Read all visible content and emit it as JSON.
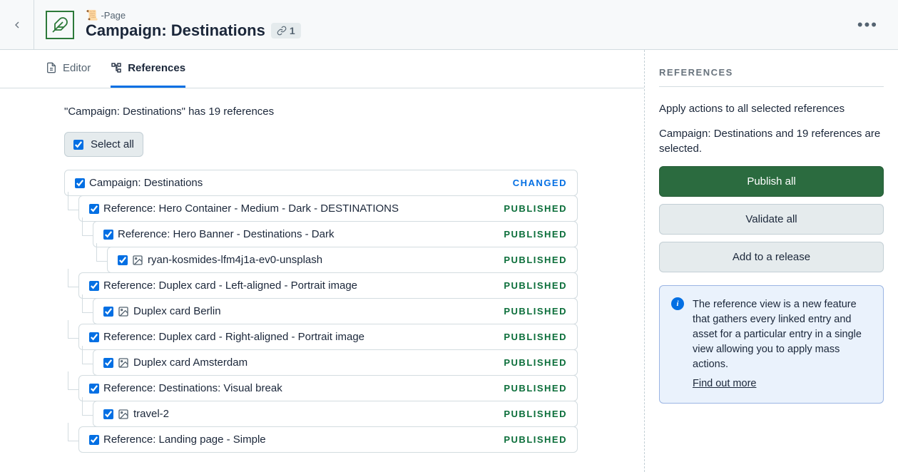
{
  "header": {
    "breadcrumb_prefix": "-Page",
    "title": "Campaign: Destinations",
    "link_count": "1"
  },
  "tabs": {
    "editor": "Editor",
    "references": "References"
  },
  "summary": "\"Campaign: Destinations\" has 19 references",
  "select_all_label": "Select all",
  "rows": [
    {
      "label": "Campaign: Destinations",
      "status": "CHANGED",
      "statusClass": "changed",
      "indent": 0,
      "isAsset": false
    },
    {
      "label": "Reference: Hero Container - Medium - Dark - DESTINATIONS",
      "status": "PUBLISHED",
      "statusClass": "published",
      "indent": 1,
      "isAsset": false
    },
    {
      "label": "Reference: Hero Banner - Destinations - Dark",
      "status": "PUBLISHED",
      "statusClass": "published",
      "indent": 2,
      "isAsset": false
    },
    {
      "label": "ryan-kosmides-lfm4j1a-ev0-unsplash",
      "status": "PUBLISHED",
      "statusClass": "published",
      "indent": 3,
      "isAsset": true
    },
    {
      "label": "Reference: Duplex card - Left-aligned - Portrait image",
      "status": "PUBLISHED",
      "statusClass": "published",
      "indent": 1,
      "isAsset": false
    },
    {
      "label": "Duplex card Berlin",
      "status": "PUBLISHED",
      "statusClass": "published",
      "indent": 2,
      "isAsset": true
    },
    {
      "label": "Reference: Duplex card - Right-aligned - Portrait image",
      "status": "PUBLISHED",
      "statusClass": "published",
      "indent": 1,
      "isAsset": false
    },
    {
      "label": "Duplex card Amsterdam",
      "status": "PUBLISHED",
      "statusClass": "published",
      "indent": 2,
      "isAsset": true
    },
    {
      "label": "Reference: Destinations: Visual break",
      "status": "PUBLISHED",
      "statusClass": "published",
      "indent": 1,
      "isAsset": false
    },
    {
      "label": "travel-2",
      "status": "PUBLISHED",
      "statusClass": "published",
      "indent": 2,
      "isAsset": true
    },
    {
      "label": "Reference: Landing page - Simple",
      "status": "PUBLISHED",
      "statusClass": "published",
      "indent": 1,
      "isAsset": false
    }
  ],
  "sidebar": {
    "heading": "REFERENCES",
    "desc": "Apply actions to all selected references",
    "selected_text": "Campaign: Destinations and 19 references are selected.",
    "publish_label": "Publish all",
    "validate_label": "Validate all",
    "release_label": "Add to a release",
    "info_text": "The reference view is a new feature that gathers every linked entry and asset for a particular entry in a single view allowing you to apply mass actions.",
    "info_link": "Find out more"
  }
}
